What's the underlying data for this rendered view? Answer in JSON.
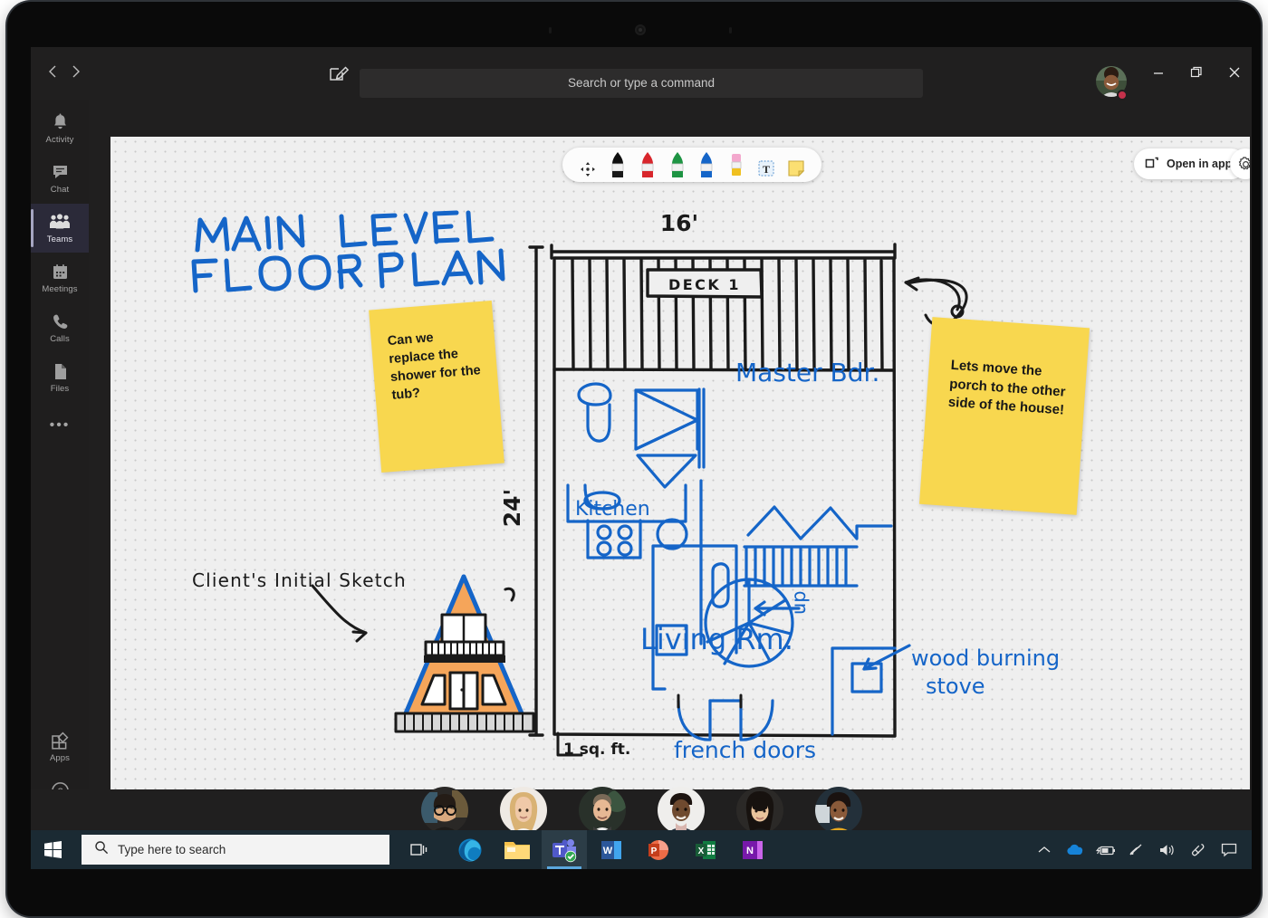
{
  "app": {
    "name": "Microsoft Teams",
    "titlebar": {
      "back_icon": "chevron-left-icon",
      "forward_icon": "chevron-right-icon",
      "compose_icon": "compose-icon",
      "search_placeholder": "Search or type a command",
      "presence_color": "#c4314b",
      "minimize_label": "—",
      "maximize_label": "❐",
      "close_label": "✕"
    },
    "rail": {
      "items": [
        {
          "id": "activity",
          "label": "Activity",
          "icon": "bell-icon",
          "active": false
        },
        {
          "id": "chat",
          "label": "Chat",
          "icon": "chat-icon",
          "active": false
        },
        {
          "id": "teams",
          "label": "Teams",
          "icon": "people-icon",
          "active": true
        },
        {
          "id": "meetings",
          "label": "Meetings",
          "icon": "calendar-icon",
          "active": false
        },
        {
          "id": "calls",
          "label": "Calls",
          "icon": "phone-icon",
          "active": false
        },
        {
          "id": "files",
          "label": "Files",
          "icon": "file-icon",
          "active": false
        }
      ],
      "more_label": "•••",
      "bottom_items": [
        {
          "id": "apps",
          "label": "Apps",
          "icon": "apps-icon"
        },
        {
          "id": "help",
          "label": "Help",
          "icon": "question-circle-icon"
        }
      ]
    }
  },
  "whiteboard": {
    "accent_ink": "#1565c8",
    "black_ink": "#1a1a1a",
    "note_color": "#f8d74f",
    "toolbar": {
      "tools": [
        {
          "id": "select",
          "name": "move-select-tool",
          "label": "Select"
        },
        {
          "id": "pen-black",
          "name": "pen-black-tool",
          "label": "Black pen",
          "color": "#1a1a1a"
        },
        {
          "id": "pen-red",
          "name": "pen-red-tool",
          "label": "Red pen",
          "color": "#d8262c"
        },
        {
          "id": "pen-green",
          "name": "pen-green-tool",
          "label": "Green pen",
          "color": "#1e9443"
        },
        {
          "id": "pen-blue",
          "name": "pen-blue-tool",
          "label": "Blue pen",
          "color": "#1565c8"
        },
        {
          "id": "eraser",
          "name": "eraser-tool",
          "label": "Eraser",
          "color": "#f0a0c8"
        },
        {
          "id": "text",
          "name": "text-tool",
          "label": "Text"
        },
        {
          "id": "note",
          "name": "sticky-note-tool",
          "label": "Sticky note"
        }
      ]
    },
    "open_in_app": {
      "label": "Open in app",
      "icon": "open-external-icon"
    },
    "settings": {
      "icon": "gear-icon"
    },
    "ink_text": {
      "title_line1": "MAIN LEVEL",
      "title_line2": "FLOOR PLAN",
      "dim_width": "16'",
      "dim_height": "24'",
      "deck_label": "DECK 1",
      "room_master": "Master Bdr.",
      "room_kitchen": "Kitchen",
      "room_living": "Living Rm.",
      "stairs_up": "up",
      "stove_line1": "wood burning",
      "stove_line2": "stove",
      "french_doors": "french doors",
      "scale_label": "1 sq. ft.",
      "client_sketch": "Client's Initial Sketch"
    },
    "sticky_notes": [
      {
        "id": "note-shower",
        "text": "Can we replace the shower for the tub?"
      },
      {
        "id": "note-porch",
        "text": "Lets move the porch to the other side of the house!"
      }
    ]
  },
  "roster": {
    "participants": [
      {
        "id": "p1",
        "name": "participant-1",
        "skin": "#d9a97e",
        "hair": "#241c16",
        "bg": "#2a2826",
        "glasses": true
      },
      {
        "id": "p2",
        "name": "participant-2",
        "skin": "#f0c9a8",
        "hair": "#d9b274",
        "bg": "#efeae4",
        "glasses": false
      },
      {
        "id": "p3",
        "name": "participant-3",
        "skin": "#e6b894",
        "hair": "#7a6a58",
        "bg": "#29312a",
        "glasses": false
      },
      {
        "id": "p4",
        "name": "participant-4",
        "skin": "#6f4a2f",
        "hair": "#1d1410",
        "bg": "#efeeec",
        "glasses": false
      },
      {
        "id": "p5",
        "name": "participant-5",
        "skin": "#e8c39c",
        "hair": "#17120f",
        "bg": "#2b2927",
        "glasses": false
      },
      {
        "id": "p6",
        "name": "participant-6",
        "skin": "#8a5a3a",
        "hair": "#1a1210",
        "bg": "#23303a",
        "glasses": false
      }
    ]
  },
  "taskbar": {
    "start_icon": "windows-logo-icon",
    "search_placeholder": "Type here to search",
    "search_icon": "search-icon",
    "taskview_icon": "task-view-icon",
    "apps": [
      {
        "id": "edge",
        "label": "Microsoft Edge",
        "icon": "edge-icon",
        "running": false
      },
      {
        "id": "explorer",
        "label": "File Explorer",
        "icon": "folder-icon",
        "running": false
      },
      {
        "id": "teams",
        "label": "Microsoft Teams",
        "icon": "teams-icon",
        "running": true
      },
      {
        "id": "word",
        "label": "Word",
        "icon": "word-icon",
        "running": false
      },
      {
        "id": "powerpoint",
        "label": "PowerPoint",
        "icon": "powerpoint-icon",
        "running": false
      },
      {
        "id": "excel",
        "label": "Excel",
        "icon": "excel-icon",
        "running": false
      },
      {
        "id": "onenote",
        "label": "OneNote",
        "icon": "onenote-icon",
        "running": false
      }
    ],
    "tray": [
      {
        "id": "overflow",
        "icon": "chevron-up-icon"
      },
      {
        "id": "onedrive",
        "icon": "onedrive-icon"
      },
      {
        "id": "battery",
        "icon": "battery-charging-icon"
      },
      {
        "id": "network",
        "icon": "wifi-icon"
      },
      {
        "id": "volume",
        "icon": "speaker-icon"
      },
      {
        "id": "pen-menu",
        "icon": "pen-icon"
      },
      {
        "id": "action-center",
        "icon": "action-center-icon"
      }
    ]
  }
}
